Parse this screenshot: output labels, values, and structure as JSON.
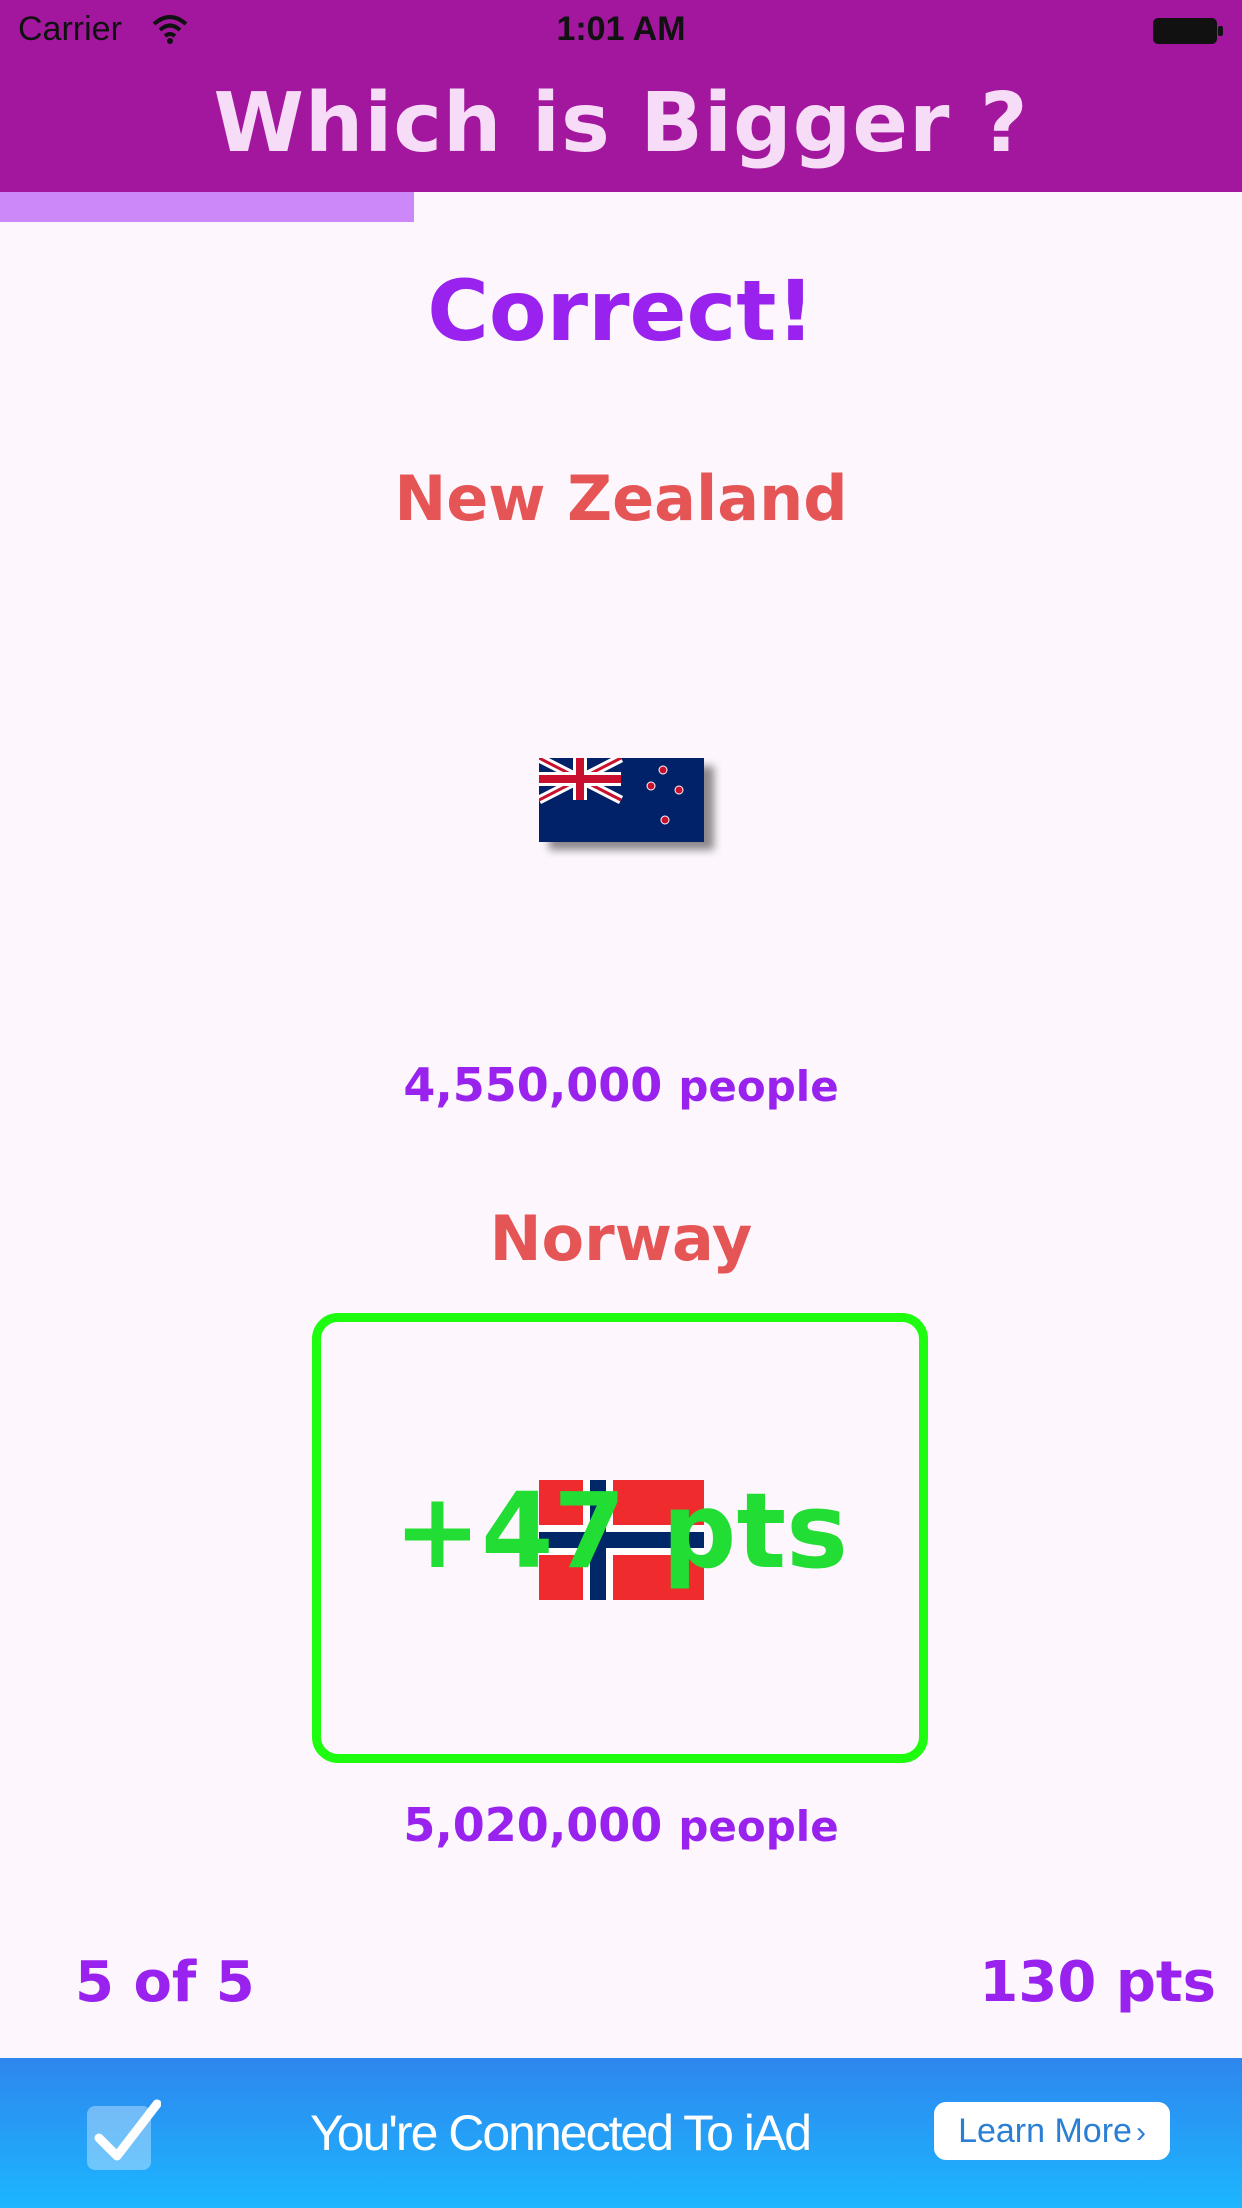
{
  "status_bar": {
    "carrier": "Carrier",
    "time": "1:01 AM",
    "wifi_icon": "wifi-icon",
    "battery_icon": "battery-icon"
  },
  "nav": {
    "title": "Which is Bigger ?"
  },
  "progress": {
    "fraction": 0.333,
    "color": "#cc88f8"
  },
  "result": {
    "title": "Correct!"
  },
  "country_a": {
    "name": "New Zealand",
    "population_value": "4,550,000",
    "population_unit": "people",
    "flag_icon": "new-zealand-flag-icon"
  },
  "country_b": {
    "name": "Norway",
    "population_value": "5,020,000",
    "population_unit": "people",
    "flag_icon": "norway-flag-icon",
    "points_gained": "+47 pts"
  },
  "footer": {
    "question_progress": "5 of 5",
    "score": "130 pts"
  },
  "ad": {
    "text": "You're Connected To iAd",
    "button_label": "Learn More",
    "icon": "checkmark-icon"
  },
  "colors": {
    "header": "#a3179f",
    "accent": "#9922ee",
    "country_name": "#e55555",
    "correct_frame": "#1efc0f",
    "points": "#22dd33"
  }
}
